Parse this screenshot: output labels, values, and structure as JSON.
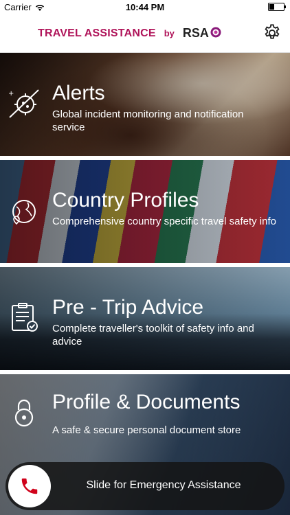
{
  "status_bar": {
    "carrier": "Carrier",
    "time": "10:44 PM",
    "battery_level": 0.35
  },
  "header": {
    "title": "TRAVEL ASSISTANCE",
    "by": "by",
    "brand": "RSA"
  },
  "tiles": [
    {
      "title": "Alerts",
      "subtitle": "Global incident monitoring and notification service",
      "icon": "virus-alert-icon"
    },
    {
      "title": "Country Profiles",
      "subtitle": "Comprehensive country specific travel safety info",
      "icon": "globe-pin-icon"
    },
    {
      "title": "Pre - Trip Advice",
      "subtitle": "Complete traveller's toolkit of safety info and advice",
      "icon": "clipboard-check-icon"
    },
    {
      "title": "Profile & Documents",
      "subtitle": "A safe & secure personal document store",
      "icon": "padlock-icon"
    }
  ],
  "emergency": {
    "label": "Slide for Emergency Assistance",
    "icon": "phone-icon",
    "accent": "#d0021b"
  },
  "colors": {
    "brand": "#b0145a"
  }
}
